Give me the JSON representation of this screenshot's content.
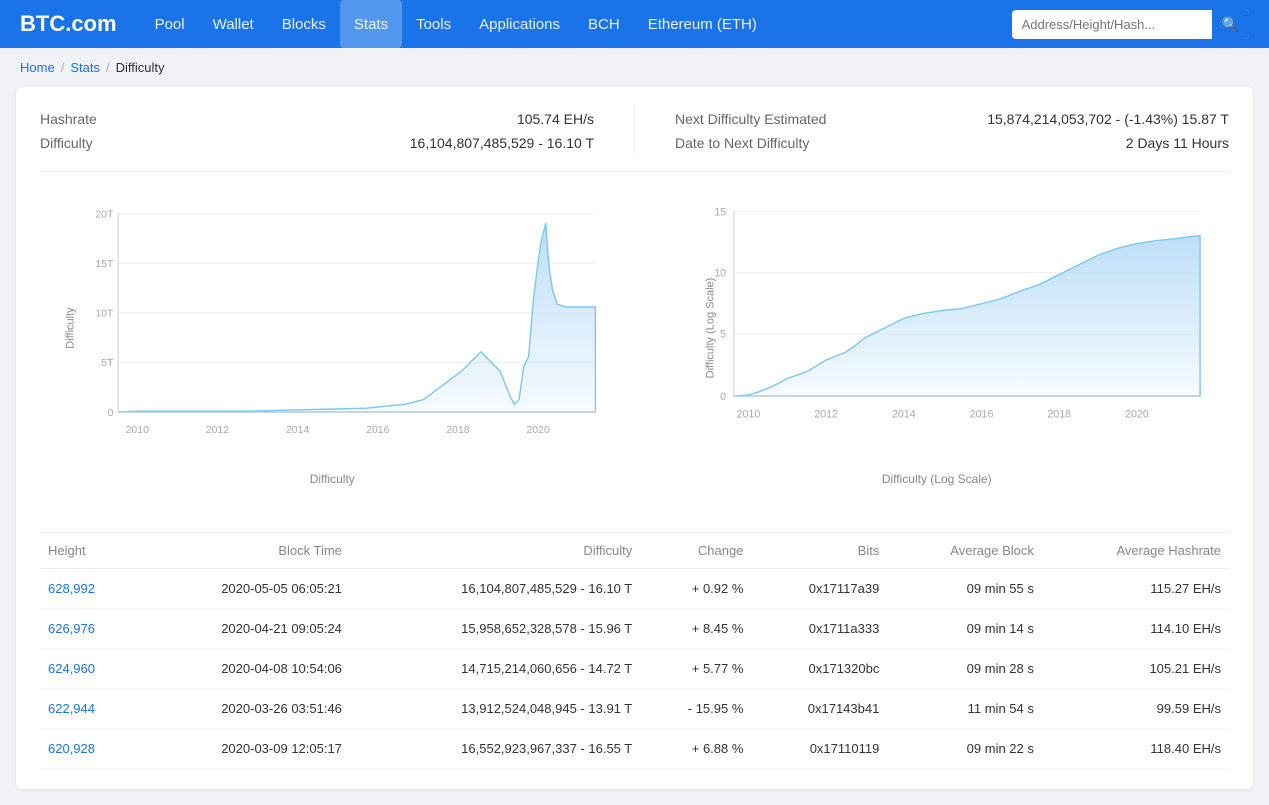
{
  "brand": "BTC.com",
  "nav": {
    "links": [
      {
        "label": "Pool",
        "active": false
      },
      {
        "label": "Wallet",
        "active": false
      },
      {
        "label": "Blocks",
        "active": false
      },
      {
        "label": "Stats",
        "active": true
      },
      {
        "label": "Tools",
        "active": false
      },
      {
        "label": "Applications",
        "active": false
      },
      {
        "label": "BCH",
        "active": false
      },
      {
        "label": "Ethereum (ETH)",
        "active": false
      }
    ],
    "search_placeholder": "Address/Height/Hash..."
  },
  "breadcrumb": {
    "items": [
      {
        "label": "Home",
        "link": true
      },
      {
        "label": "Stats",
        "link": true
      },
      {
        "label": "Difficulty",
        "link": false
      }
    ]
  },
  "stats": {
    "left": {
      "hashrate_label": "Hashrate",
      "hashrate_value": "105.74 EH/s",
      "difficulty_label": "Difficulty",
      "difficulty_value": "16,104,807,485,529 - 16.10 T"
    },
    "right": {
      "next_difficulty_label": "Next Difficulty Estimated",
      "next_difficulty_value": "15,874,214,053,702 - (-1.43%) 15.87 T",
      "date_label": "Date to Next Difficulty",
      "date_value": "2 Days 11 Hours"
    }
  },
  "chart1": {
    "title": "Difficulty",
    "y_label": "Difficulty",
    "x_label": "Difficulty",
    "y_ticks": [
      "20T",
      "15T",
      "10T",
      "5T",
      "0"
    ],
    "x_ticks": [
      "2010",
      "2012",
      "2014",
      "2016",
      "2018",
      "2020"
    ]
  },
  "chart2": {
    "title": "Difficulty (Log Scale)",
    "y_label": "Difficulty (Log Scale)",
    "x_label": "Difficulty (Log Scale)",
    "y_ticks": [
      "15",
      "10",
      "5",
      "0"
    ],
    "x_ticks": [
      "2010",
      "2012",
      "2014",
      "2016",
      "2018",
      "2020"
    ]
  },
  "table": {
    "headers": [
      "Height",
      "Block Time",
      "Difficulty",
      "Change",
      "Bits",
      "Average Block",
      "Average Hashrate"
    ],
    "rows": [
      {
        "height": "628,992",
        "block_time": "2020-05-05 06:05:21",
        "difficulty": "16,104,807,485,529 - 16.10 T",
        "change": "+ 0.92 %",
        "change_type": "pos",
        "bits": "0x17117a39",
        "avg_block": "09 min 55 s",
        "avg_hashrate": "115.27 EH/s"
      },
      {
        "height": "626,976",
        "block_time": "2020-04-21 09:05:24",
        "difficulty": "15,958,652,328,578 - 15.96 T",
        "change": "+ 8.45 %",
        "change_type": "pos",
        "bits": "0x1711a333",
        "avg_block": "09 min 14 s",
        "avg_hashrate": "114.10 EH/s"
      },
      {
        "height": "624,960",
        "block_time": "2020-04-08 10:54:06",
        "difficulty": "14,715,214,060,656 - 14.72 T",
        "change": "+ 5.77 %",
        "change_type": "pos",
        "bits": "0x171320bc",
        "avg_block": "09 min 28 s",
        "avg_hashrate": "105.21 EH/s"
      },
      {
        "height": "622,944",
        "block_time": "2020-03-26 03:51:46",
        "difficulty": "13,912,524,048,945 - 13.91 T",
        "change": "- 15.95 %",
        "change_type": "neg",
        "bits": "0x17143b41",
        "avg_block": "11 min 54 s",
        "avg_hashrate": "99.59 EH/s"
      },
      {
        "height": "620,928",
        "block_time": "2020-03-09 12:05:17",
        "difficulty": "16,552,923,967,337 - 16.55 T",
        "change": "+ 6.88 %",
        "change_type": "pos",
        "bits": "0x17110119",
        "avg_block": "09 min 22 s",
        "avg_hashrate": "118.40 EH/s"
      }
    ]
  }
}
